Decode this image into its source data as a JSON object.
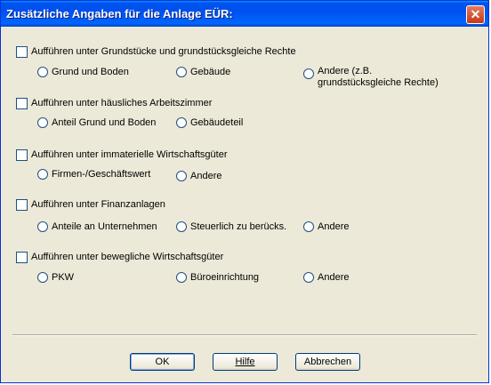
{
  "window": {
    "title": "Zusätzliche Angaben für die Anlage EÜR:",
    "close_glyph": "✕"
  },
  "groups": [
    {
      "checkbox_label": "Aufführen unter Grundstücke und  grundstücksgleiche Rechte",
      "options": [
        "Grund und Boden",
        "Gebäude",
        "Andere (z.B.\ngrundstücksgleiche Rechte)"
      ]
    },
    {
      "checkbox_label": "Aufführen unter häusliches Arbeitszimmer",
      "options": [
        "Anteil Grund und Boden",
        "Gebäudeteil"
      ]
    },
    {
      "checkbox_label": "Aufführen unter immaterielle Wirtschaftsgüter",
      "options": [
        "Firmen-/Geschäftswert",
        "Andere"
      ]
    },
    {
      "checkbox_label": "Aufführen unter Finanzanlagen",
      "options": [
        "Anteile an Unternehmen",
        "Steuerlich zu berücks.",
        "Andere"
      ]
    },
    {
      "checkbox_label": "Aufführen unter bewegliche Wirtschaftsgüter",
      "options": [
        "PKW",
        "Büroeinrichtung",
        "Andere"
      ]
    }
  ],
  "buttons": {
    "ok": "OK",
    "help": "Hilfe",
    "cancel": "Abbrechen"
  }
}
